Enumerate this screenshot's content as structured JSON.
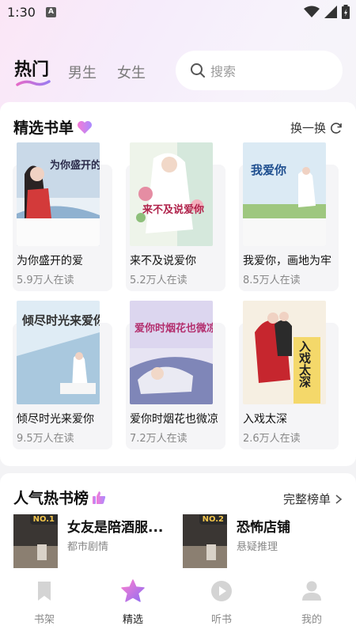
{
  "status_bar": {
    "time": "1:30",
    "a_badge": "A"
  },
  "header": {
    "tabs": [
      {
        "label": "热门",
        "active": true
      },
      {
        "label": "男生",
        "active": false
      },
      {
        "label": "女生",
        "active": false
      }
    ],
    "search": {
      "placeholder": "搜索",
      "icon": "search-icon"
    }
  },
  "featured": {
    "title": "精选书单",
    "title_icon": "heart-icon",
    "action_label": "换一换",
    "action_icon": "refresh-icon",
    "books": [
      {
        "title": "为你盛开的爱",
        "readers": "5.9万人在读",
        "cover_title": "为你盛开的爱"
      },
      {
        "title": "来不及说爱你",
        "readers": "5.2万人在读",
        "cover_title": "来不及说爱你"
      },
      {
        "title": "我爱你，画地为牢",
        "readers": "8.5万人在读",
        "cover_title": "我爱你"
      },
      {
        "title": "倾尽时光来爱你",
        "readers": "9.5万人在读",
        "cover_title": "倾尽时光来爱你"
      },
      {
        "title": "爱你时烟花也微凉",
        "readers": "7.2万人在读",
        "cover_title": "爱你时烟花也微凉"
      },
      {
        "title": "入戏太深",
        "readers": "2.6万人在读",
        "cover_title": "入戏太深"
      }
    ]
  },
  "ranking": {
    "title": "人气热书榜",
    "title_icon": "thumbs-up-icon",
    "action_label": "完整榜单",
    "items": [
      {
        "rank": "NO.1",
        "title": "女友是陪酒服...",
        "genre": "都市剧情"
      },
      {
        "rank": "NO.2",
        "title": "恐怖店铺",
        "genre": "悬疑推理"
      }
    ]
  },
  "bottom_nav": {
    "items": [
      {
        "label": "书架",
        "icon": "bookmark-icon",
        "active": false
      },
      {
        "label": "精选",
        "icon": "star-icon",
        "active": true
      },
      {
        "label": "听书",
        "icon": "play-icon",
        "active": false
      },
      {
        "label": "我的",
        "icon": "user-icon",
        "active": false
      }
    ]
  },
  "colors": {
    "accent_pink": "#e46ac8",
    "accent_purple": "#9b7bf0",
    "muted_text": "#888888"
  }
}
